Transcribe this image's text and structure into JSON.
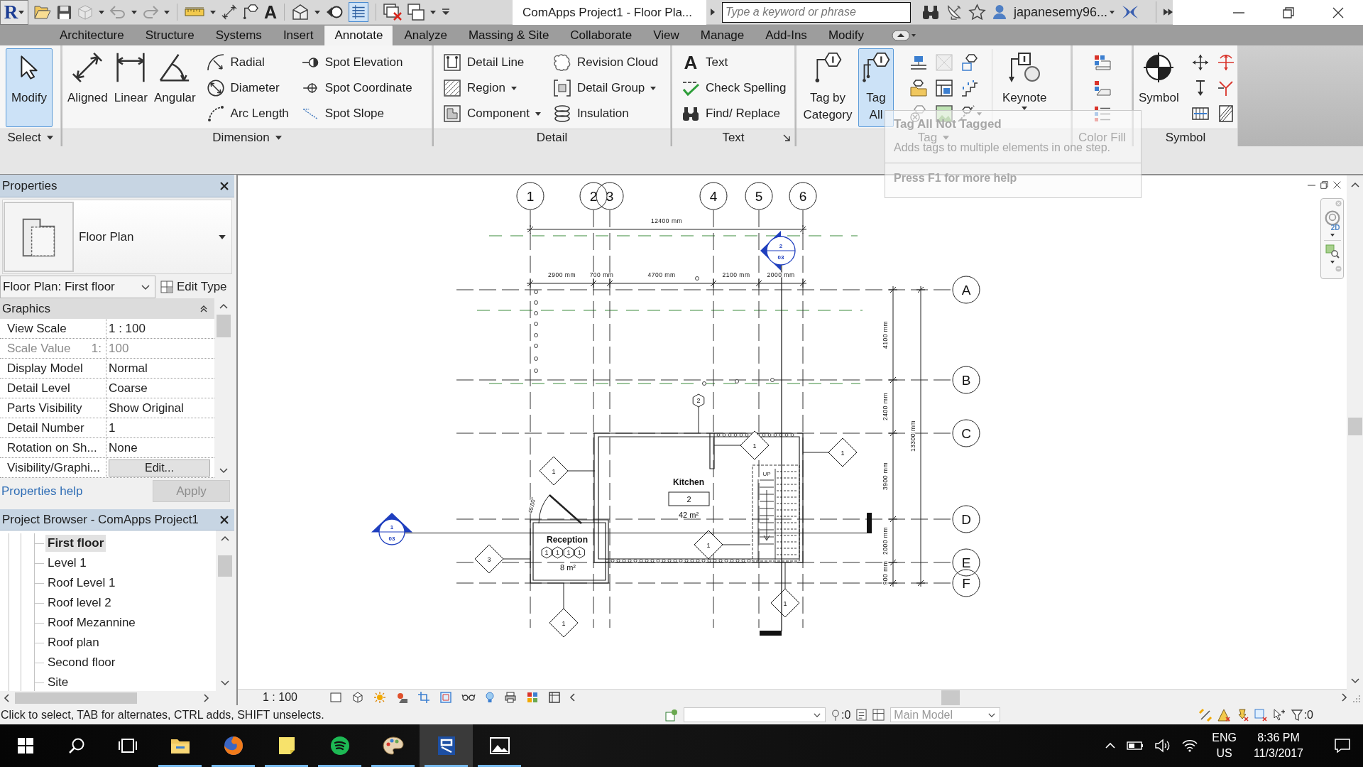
{
  "quick_access": {
    "logo": "R",
    "text_glyph": "A",
    "thin_lines": true
  },
  "title_bar": {
    "title": "ComApps Project1 - Floor Pla...",
    "search": {
      "placeholder": "Type a keyword or phrase"
    },
    "user": "japanesemy96..."
  },
  "ribbon_tabs": [
    {
      "label": "Architecture",
      "selected": false
    },
    {
      "label": "Structure",
      "selected": false
    },
    {
      "label": "Systems",
      "selected": false
    },
    {
      "label": "Insert",
      "selected": false
    },
    {
      "label": "Annotate",
      "selected": true
    },
    {
      "label": "Analyze",
      "selected": false
    },
    {
      "label": "Massing & Site",
      "selected": false
    },
    {
      "label": "Collaborate",
      "selected": false
    },
    {
      "label": "View",
      "selected": false
    },
    {
      "label": "Manage",
      "selected": false
    },
    {
      "label": "Add-Ins",
      "selected": false
    },
    {
      "label": "Modify",
      "selected": false
    }
  ],
  "ribbon_panels": [
    {
      "label": "Select",
      "dropdown": true,
      "launcher": false,
      "tools": [
        {
          "kind": "large",
          "label": "Modify",
          "highlighted": true,
          "dropdown": false
        }
      ]
    },
    {
      "label": "Dimension",
      "dropdown": true,
      "launcher": false,
      "tools": [
        {
          "kind": "large",
          "label": "Aligned",
          "highlighted": false,
          "dropdown": false
        },
        {
          "kind": "large",
          "label": "Linear",
          "highlighted": false,
          "dropdown": false
        },
        {
          "kind": "large",
          "label": "Angular",
          "highlighted": false,
          "dropdown": false
        },
        {
          "kind": "small",
          "label": "Radial",
          "highlighted": false,
          "dropdown": false
        },
        {
          "kind": "small",
          "label": "Diameter",
          "highlighted": false,
          "dropdown": false
        },
        {
          "kind": "small",
          "label": "Arc Length",
          "highlighted": false,
          "dropdown": false
        },
        {
          "kind": "small",
          "label": "Spot Elevation",
          "highlighted": false,
          "dropdown": false
        },
        {
          "kind": "small",
          "label": "Spot Coordinate",
          "highlighted": false,
          "dropdown": false
        },
        {
          "kind": "small",
          "label": "Spot Slope",
          "highlighted": false,
          "dropdown": false
        }
      ]
    },
    {
      "label": "Detail",
      "dropdown": false,
      "launcher": false,
      "tools": [
        {
          "kind": "small",
          "label": "Detail Line",
          "highlighted": false,
          "dropdown": false
        },
        {
          "kind": "small",
          "label": "Region",
          "highlighted": false,
          "dropdown": true
        },
        {
          "kind": "small",
          "label": "Component",
          "highlighted": false,
          "dropdown": true
        },
        {
          "kind": "small",
          "label": "Revision Cloud",
          "highlighted": false,
          "dropdown": false
        },
        {
          "kind": "small",
          "label": "Detail Group",
          "highlighted": false,
          "dropdown": true
        },
        {
          "kind": "small",
          "label": "Insulation",
          "highlighted": false,
          "dropdown": false
        }
      ]
    },
    {
      "label": "Text",
      "dropdown": false,
      "launcher": true,
      "tools": [
        {
          "kind": "glyph",
          "label": "Text",
          "glyph": "A",
          "highlighted": false,
          "dropdown": false
        },
        {
          "kind": "small",
          "label": "Check Spelling",
          "highlighted": false,
          "dropdown": false
        },
        {
          "kind": "small",
          "label": "Find/ Replace",
          "highlighted": false,
          "dropdown": false
        }
      ]
    },
    {
      "label": "Tag",
      "dropdown": true,
      "launcher": false,
      "tools": [
        {
          "kind": "large",
          "label": "Tag by Category",
          "highlighted": false,
          "dropdown": false
        },
        {
          "kind": "large",
          "label": "Tag All",
          "highlighted": true,
          "dropdown": false
        },
        {
          "kind": "large",
          "label": "Keynote",
          "highlighted": false,
          "dropdown": true
        }
      ]
    },
    {
      "label": "Color Fill",
      "dropdown": false,
      "launcher": false
    },
    {
      "label": "Symbol",
      "dropdown": false,
      "launcher": false,
      "tools": [
        {
          "kind": "large",
          "label": "Symbol",
          "highlighted": false,
          "dropdown": false
        }
      ]
    }
  ],
  "tooltip": {
    "title": "Tag All Not Tagged",
    "description": "Adds tags to multiple elements in one step.",
    "help": "Press F1 for more help"
  },
  "properties": {
    "title": "Properties",
    "type_name": "Floor Plan",
    "instance": "Floor Plan: First floor",
    "edit_type": "Edit Type",
    "group": "Graphics",
    "rows": [
      {
        "name": "View Scale",
        "value": "1 : 100",
        "kind": "text",
        "disabled": false
      },
      {
        "name": "Scale Value",
        "suffix": "1:",
        "value": "100",
        "kind": "text",
        "disabled": true
      },
      {
        "name": "Display Model",
        "value": "Normal",
        "kind": "text",
        "disabled": false
      },
      {
        "name": "Detail Level",
        "value": "Coarse",
        "kind": "text",
        "disabled": false
      },
      {
        "name": "Parts Visibility",
        "value": "Show Original",
        "kind": "text",
        "disabled": false
      },
      {
        "name": "Detail Number",
        "value": "1",
        "kind": "text",
        "disabled": false
      },
      {
        "name": "Rotation on Sh...",
        "value": "None",
        "kind": "text",
        "disabled": false
      },
      {
        "name": "Visibility/Graphi...",
        "value": "Edit...",
        "kind": "button",
        "disabled": false
      }
    ],
    "help_link": "Properties help",
    "apply": {
      "label": "Apply",
      "disabled": true
    }
  },
  "project_browser": {
    "title": "Project Browser - ComApps Project1",
    "items": [
      {
        "label": "First floor",
        "selected": true
      },
      {
        "label": "Level 1",
        "selected": false
      },
      {
        "label": "Roof Level 1",
        "selected": false
      },
      {
        "label": "Roof level 2",
        "selected": false
      },
      {
        "label": "Roof Mezannine",
        "selected": false
      },
      {
        "label": "Roof plan",
        "selected": false
      },
      {
        "label": "Second floor",
        "selected": false
      },
      {
        "label": "Site",
        "selected": false
      }
    ]
  },
  "plan": {
    "grid_columns": [
      "1",
      "2",
      "3",
      "4",
      "5",
      "6"
    ],
    "grid_rows": [
      "A",
      "B",
      "C",
      "D",
      "E",
      "F"
    ],
    "overall_width": "12400 mm",
    "bay_widths": [
      "2900 mm",
      "700 mm",
      "4700 mm",
      "2100 mm",
      "2000 mm"
    ],
    "overall_depth": "13300 mm",
    "bay_depths": [
      "4100 mm",
      "2400 mm",
      "3900 mm",
      "2000 mm",
      "900 mm"
    ],
    "rooms": [
      {
        "name": "Kitchen",
        "number": "2",
        "area": "42 m²"
      },
      {
        "name": "Reception",
        "area": "8 m²"
      }
    ],
    "diamond_tags": [
      "1",
      "1",
      "1",
      "1",
      "3",
      "1",
      "1"
    ],
    "hexagon_tags": [
      "2",
      "1",
      "1",
      "1",
      "1"
    ],
    "sections": [
      {
        "number": "1",
        "sheet": "03"
      },
      {
        "number": "2",
        "sheet": "03"
      }
    ],
    "stair_label": "UP",
    "door_angle": "45.00°"
  },
  "view_bar": {
    "scale": "1 : 100"
  },
  "nav_bar": {
    "wheel_label": "2D"
  },
  "status_bar": {
    "message": "Click to select, TAB for alternates, CTRL adds, SHIFT unselects.",
    "selection_count": ":0",
    "workset": "Main Model",
    "filter_count": ":0"
  },
  "taskbar": {
    "apps": [
      {
        "kind": "folder",
        "running": true,
        "active": false
      },
      {
        "kind": "browser",
        "running": true,
        "active": false
      },
      {
        "kind": "note",
        "running": true,
        "active": false
      },
      {
        "kind": "music",
        "running": true,
        "active": false
      },
      {
        "kind": "palette",
        "running": true,
        "active": false
      },
      {
        "kind": "app",
        "running": true,
        "active": true
      },
      {
        "kind": "image",
        "running": true,
        "active": false
      }
    ],
    "language": "ENG",
    "region": "US",
    "time": "8:36 PM",
    "date": "11/3/2017"
  }
}
